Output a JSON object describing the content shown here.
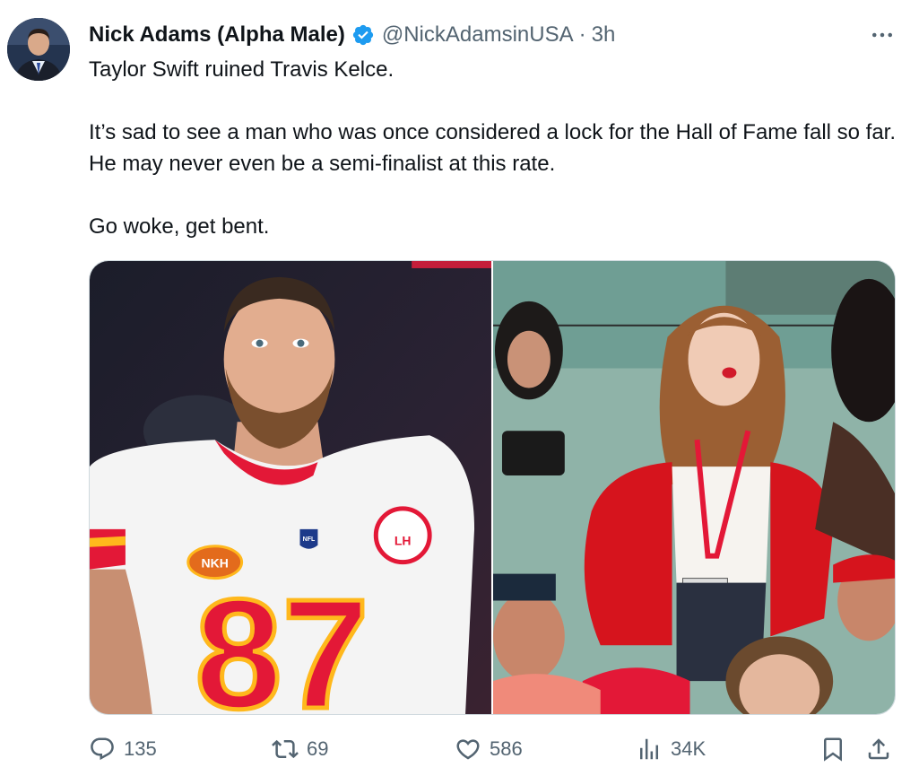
{
  "author": {
    "display_name": "Nick Adams (Alpha Male)",
    "handle": "@NickAdamsinUSA",
    "separator": "·",
    "time": "3h",
    "verified_icon": "verified-badge-icon"
  },
  "tweet": {
    "lines": [
      "Taylor Swift ruined Travis Kelce.",
      "It’s sad to see a man who was once considered a lock for the Hall of Fame fall so far. He may never even be a semi-finalist at this rate.",
      "Go woke, get bent."
    ]
  },
  "media": {
    "left_jersey_number": "87",
    "left_patch": "NKH",
    "left_badge": "LH",
    "left_shield": "NFL"
  },
  "actions": {
    "reply": {
      "icon": "reply-icon",
      "count": "135"
    },
    "retweet": {
      "icon": "retweet-icon",
      "count": "69"
    },
    "like": {
      "icon": "heart-icon",
      "count": "586"
    },
    "views": {
      "icon": "views-chart-icon",
      "count": "34K"
    },
    "bookmark": {
      "icon": "bookmark-icon"
    },
    "share": {
      "icon": "share-icon"
    }
  },
  "colors": {
    "text": "#0f1419",
    "secondary": "#536471",
    "verified": "#1d9bf0",
    "chiefs_red": "#e31837",
    "chiefs_gold": "#ffb81c"
  }
}
